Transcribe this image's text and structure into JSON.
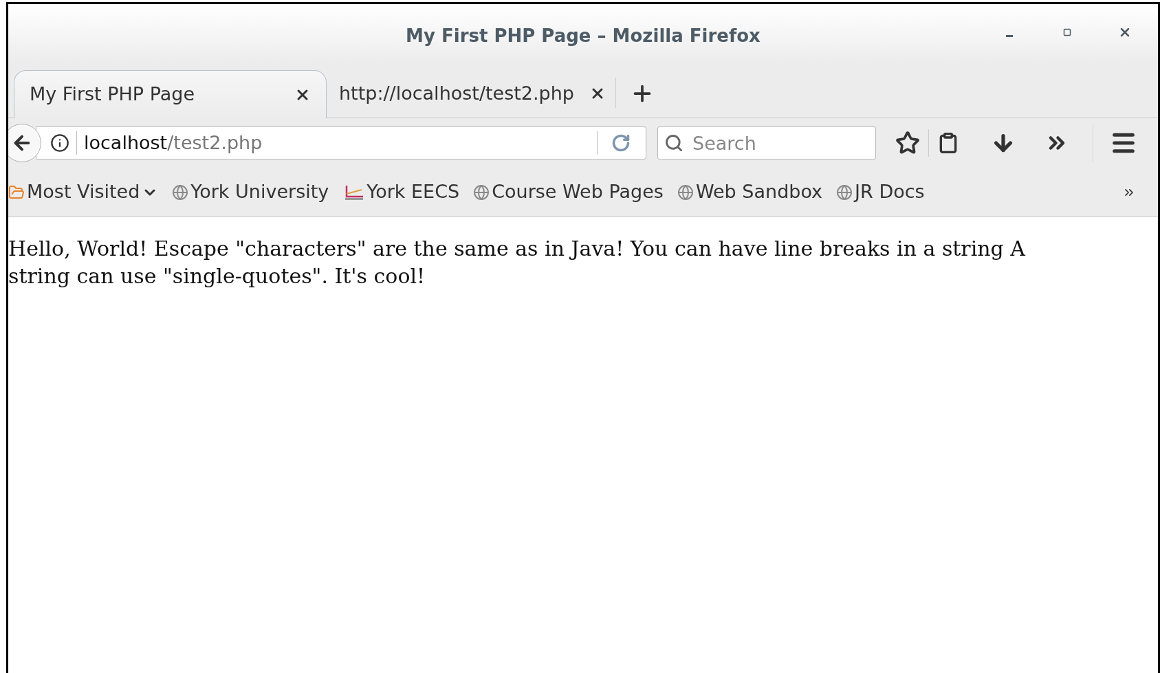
{
  "window": {
    "title": "My First PHP Page – Mozilla Firefox"
  },
  "tabs": [
    {
      "label": "My First PHP Page",
      "selected": true
    },
    {
      "label": "http://localhost/test2.php",
      "selected": false
    }
  ],
  "address_bar": {
    "host": "localhost",
    "path": "/test2.php"
  },
  "search": {
    "placeholder": "Search"
  },
  "bookmarks": [
    {
      "label": "Most Visited",
      "kind": "folder"
    },
    {
      "label": "York University",
      "kind": "globe"
    },
    {
      "label": "York EECS",
      "kind": "logo"
    },
    {
      "label": "Course Web Pages",
      "kind": "globe"
    },
    {
      "label": "Web Sandbox",
      "kind": "globe"
    },
    {
      "label": "JR Docs",
      "kind": "globe"
    }
  ],
  "page": {
    "text": "Hello, World! Escape \"characters\" are the same as in Java! You can have line breaks in a string A string can use \"single-quotes\". It's cool!"
  }
}
